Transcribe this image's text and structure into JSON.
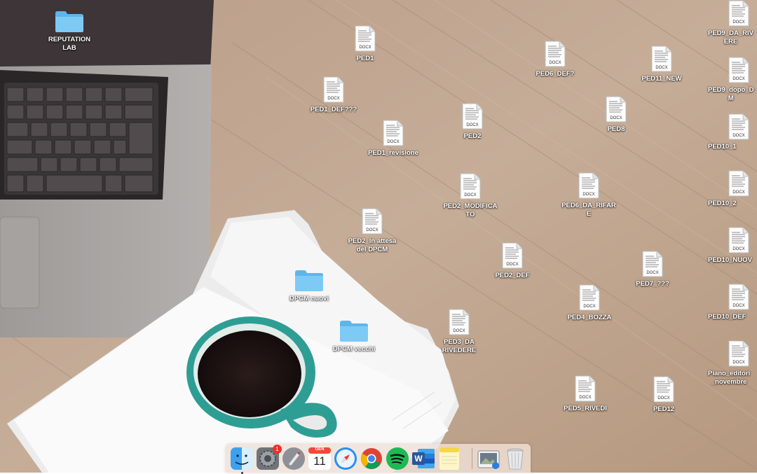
{
  "desktop": {
    "folders": [
      {
        "id": "reputation-lab",
        "label": "REPUTATION\nLAB"
      },
      {
        "id": "dpcm-nuovi",
        "label": "DPCM nuovi"
      },
      {
        "id": "dpcm-vecchi",
        "label": "DPCM vecchi"
      }
    ],
    "files": [
      {
        "label": "PED1",
        "ext": "DOCX"
      },
      {
        "label": "PED1_DEF???",
        "ext": "DOCX"
      },
      {
        "label": "PED1_revisione",
        "ext": "DOCX"
      },
      {
        "label": "PED2",
        "ext": "DOCX"
      },
      {
        "label": "PED2_MODIFICA\nTO",
        "ext": "DOCX"
      },
      {
        "label": "PED2_In attesa\ndel DPCM",
        "ext": "DOCX"
      },
      {
        "label": "PED2_DEF",
        "ext": "DOCX"
      },
      {
        "label": "PED3_DA\nRIVEDERE",
        "ext": "DOCX"
      },
      {
        "label": "PED4_BOZZA",
        "ext": "DOCX"
      },
      {
        "label": "PED5_RIVEDI",
        "ext": "DOCX"
      },
      {
        "label": "PED6_DEF?",
        "ext": "DOCX"
      },
      {
        "label": "PED6_DA_RIFAR\nE",
        "ext": "DOCX"
      },
      {
        "label": "PED7_???",
        "ext": "DOCX"
      },
      {
        "label": "PED8",
        "ext": "DOCX"
      },
      {
        "label": "PED11_NEW",
        "ext": "DOCX"
      },
      {
        "label": "PED12",
        "ext": "DOCX"
      },
      {
        "label": "PED9_DA_RIV\nERE",
        "ext": "DOCX"
      },
      {
        "label": "PED9_dopo_D\nM",
        "ext": "DOCX"
      },
      {
        "label": "PED10_1",
        "ext": "DOCX"
      },
      {
        "label": "PED10_2",
        "ext": "DOCX"
      },
      {
        "label": "PED10_NUOV",
        "ext": "DOCX"
      },
      {
        "label": "PED10_DEF",
        "ext": "DOCX"
      },
      {
        "label": "Piano_editori\n_novembre",
        "ext": "DOCX"
      }
    ]
  },
  "dock": {
    "items": [
      {
        "name": "finder-icon"
      },
      {
        "name": "system-preferences-icon",
        "badge": "1"
      },
      {
        "name": "launchpad-icon"
      },
      {
        "name": "calendar-icon",
        "month": "GEN",
        "day": "11"
      },
      {
        "name": "safari-icon"
      },
      {
        "name": "chrome-icon"
      },
      {
        "name": "spotify-icon"
      },
      {
        "name": "word-icon",
        "letter": "W"
      },
      {
        "name": "notes-icon"
      },
      {
        "name": "preview-icon"
      },
      {
        "name": "trash-icon"
      }
    ]
  },
  "colors": {
    "folder_blue": "#6cc4f2",
    "badge_red": "#e8332b",
    "spotify_green": "#1db954",
    "word_blue": "#2b5797"
  }
}
